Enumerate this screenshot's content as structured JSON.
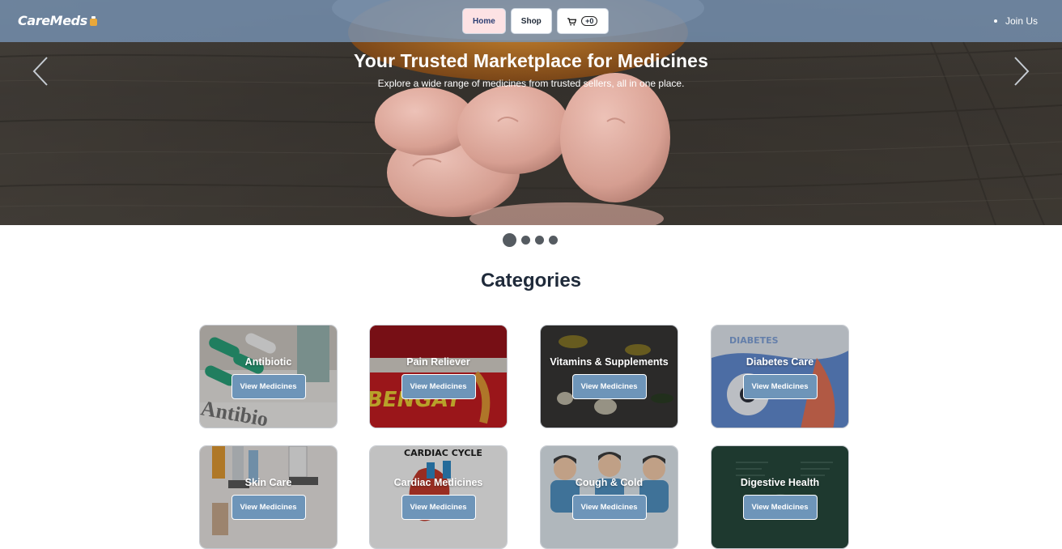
{
  "brand": {
    "logo_text": "CareMeds"
  },
  "nav": {
    "home_label": "Home",
    "shop_label": "Shop",
    "cart_count": "+0",
    "join_label": "Join Us"
  },
  "hero": {
    "title": "Your Trusted Marketplace for Medicines",
    "subtitle": "Explore a wide range of medicines from trusted sellers, all in one place.",
    "slide_count": 4,
    "active_slide": 1
  },
  "categories_section": {
    "title": "Categories",
    "button_label": "View Medicines",
    "items": [
      {
        "name": "Antibiotic"
      },
      {
        "name": "Pain Reliever"
      },
      {
        "name": "Vitamins & Supplements"
      },
      {
        "name": "Diabetes Care"
      },
      {
        "name": "Skin Care"
      },
      {
        "name": "Cardiac Medicines"
      },
      {
        "name": "Cough & Cold"
      },
      {
        "name": "Digestive Health"
      }
    ]
  },
  "colors": {
    "nav_bar": "#7896b9",
    "active_nav": "#fde2e4",
    "card_button": "#6e95b9",
    "heading": "#1f2a3a"
  },
  "icons": {
    "cart": "shopping-cart-icon",
    "prev": "chevron-left-icon",
    "next": "chevron-right-icon"
  }
}
